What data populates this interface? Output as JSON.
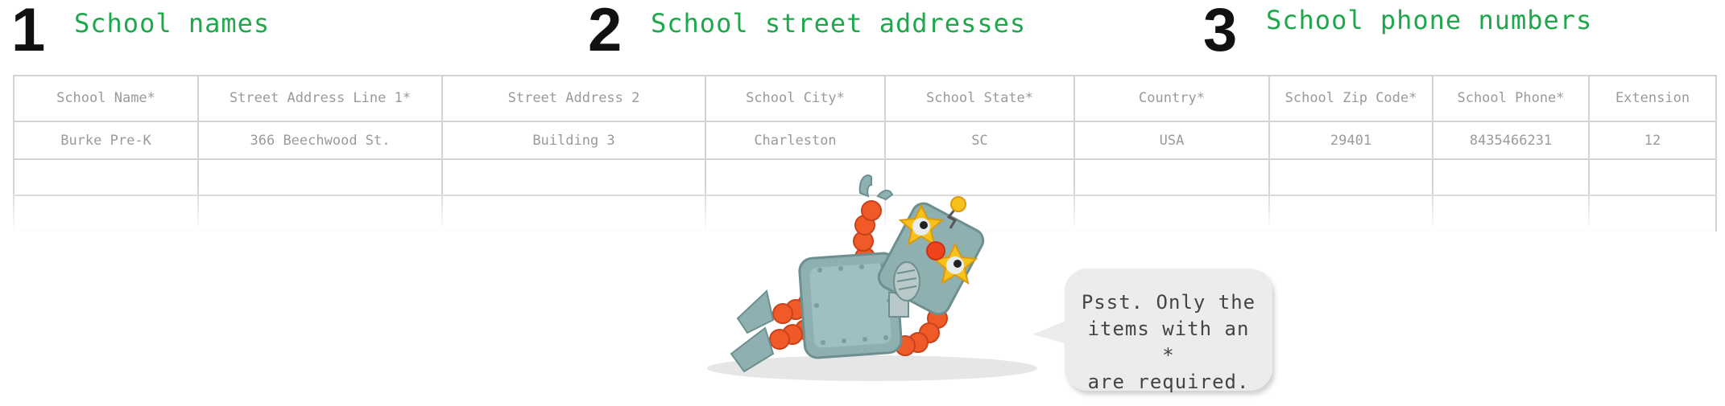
{
  "steps": [
    {
      "number": "1",
      "label": "School names"
    },
    {
      "number": "2",
      "label": "School street addresses"
    },
    {
      "number": "3",
      "label": "School phone numbers"
    }
  ],
  "table": {
    "headers": [
      "School Name*",
      "Street Address Line 1*",
      "Street Address 2",
      "School City*",
      "School State*",
      "Country*",
      "School Zip Code*",
      "School Phone*",
      "Extension"
    ],
    "rows": [
      [
        "Burke Pre-K",
        "366 Beechwood St.",
        "Building 3",
        "Charleston",
        "SC",
        "USA",
        "29401",
        "8435466231",
        "12"
      ]
    ]
  },
  "speech_bubble": {
    "text": "Psst. Only the\nitems with an *\nare required."
  },
  "colors": {
    "step_label": "#1ea84b",
    "step_number": "#111111",
    "grid_line": "#d3d3d3",
    "grid_text": "#9a9a9a",
    "bubble_background": "#ececec",
    "robot_body": "#8fb0b1",
    "robot_limbs": "#f05a28",
    "robot_glasses": "#f7c21c"
  },
  "illustration": {
    "robot_icon": "robot-mascot-icon"
  }
}
